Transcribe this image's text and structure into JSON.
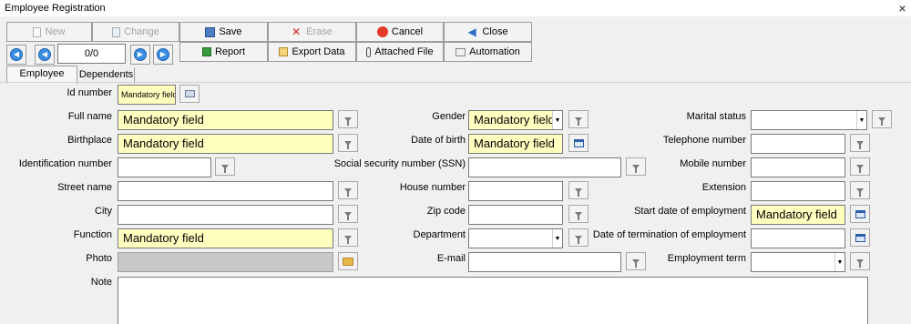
{
  "window": {
    "title": "Employee Registration",
    "close_glyph": "×"
  },
  "toolbar": {
    "new": "New",
    "change": "Change",
    "save": "Save",
    "erase": "Erase",
    "cancel": "Cancel",
    "close": "Close",
    "report": "Report",
    "export": "Export Data",
    "attached": "Attached File",
    "automation": "Automation"
  },
  "navigation": {
    "counter": "0/0"
  },
  "tabs": {
    "employee": "Employee",
    "dependents": "Dependents"
  },
  "labels": {
    "id_number": "Id number",
    "full_name": "Full name",
    "birthplace": "Birthplace",
    "identification_number": "Identification number",
    "street_name": "Street name",
    "city": "City",
    "function": "Function",
    "photo": "Photo",
    "note": "Note",
    "gender": "Gender",
    "date_of_birth": "Date of birth",
    "ssn": "Social security number (SSN)",
    "house_number": "House number",
    "zip_code": "Zip code",
    "department": "Department",
    "email": "E-mail",
    "marital_status": "Marital status",
    "telephone_number": "Telephone number",
    "mobile_number": "Mobile number",
    "extension": "Extension",
    "start_date": "Start date of employment",
    "termination_date": "Date of termination of employment",
    "employment_term": "Employment term"
  },
  "values": {
    "id_number": "Mandatory field",
    "full_name": "Mandatory field",
    "birthplace": "Mandatory field",
    "function": "Mandatory field",
    "gender": "Mandatory field",
    "date_of_birth": "Mandatory field",
    "start_date": "Mandatory field"
  },
  "colors": {
    "mandatory": "#ffffc0",
    "accent": "#3a8de0"
  }
}
